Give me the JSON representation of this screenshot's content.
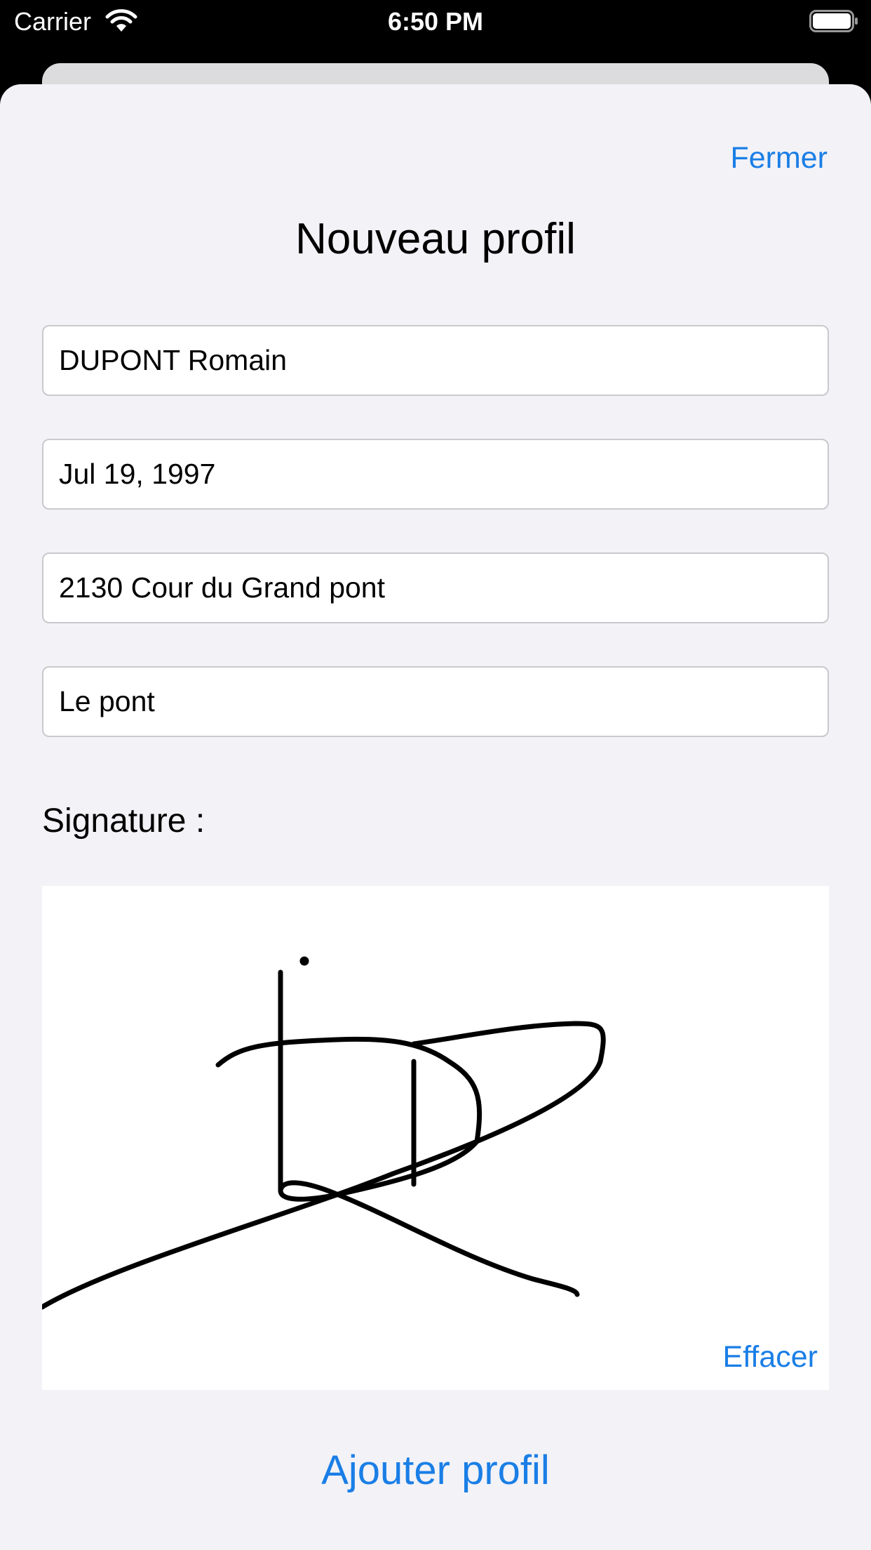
{
  "status_bar": {
    "carrier": "Carrier",
    "time": "6:50 PM",
    "wifi_icon": "wifi-icon",
    "battery_icon": "battery-full-icon"
  },
  "sheet": {
    "close_label": "Fermer",
    "title": "Nouveau profil",
    "fields": {
      "name": "DUPONT Romain",
      "birth_date": "Jul 19, 1997",
      "address": "2130 Cour du Grand pont",
      "city": "Le pont"
    },
    "signature_label": "Signature :",
    "clear_label": "Effacer",
    "add_label": "Ajouter profil"
  },
  "colors": {
    "accent": "#1a7ee6",
    "sheet_background": "#f2f2f7",
    "status_bar_background": "#000000",
    "field_border": "#c9c9ce"
  }
}
